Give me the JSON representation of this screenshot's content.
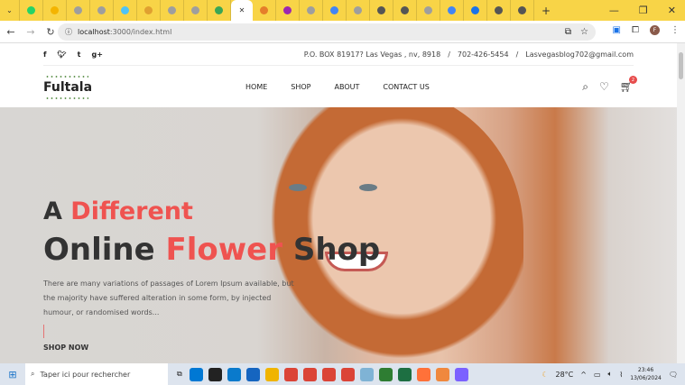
{
  "browser": {
    "tab_colors": [
      "#25d366",
      "#f4b400",
      "#9e9e9e",
      "#9e9e9e",
      "#4fc3f7",
      "#e0a030",
      "#9e9e9e",
      "#9e9e9e",
      "#3aa655"
    ],
    "tab_colors_right": [
      "#e57e2a",
      "#9c27b0",
      "#9e9e9e",
      "#4285f4",
      "#9e9e9e",
      "#555555",
      "#555555",
      "#9e9e9e",
      "#4285f4",
      "#1a73e8",
      "#555555",
      "#555555"
    ],
    "new_tab": "+",
    "minimize": "—",
    "restore": "❐",
    "close": "✕",
    "url_host": "localhost",
    "url_rest": ":3000/index.html",
    "profile_initial": "F"
  },
  "topbar": {
    "social": [
      "f",
      "t",
      "t",
      "g+"
    ],
    "address": "P.O. BOX 81917? Las Vegas , nv, 8918",
    "slash": "/",
    "phone": "702-426-5454",
    "email": "Lasvegasblog702@gmail.com"
  },
  "header": {
    "logo": "Fultala",
    "menu": [
      "HOME",
      "SHOP",
      "ABOUT",
      "CONTACT US"
    ],
    "cart_count": "2"
  },
  "hero": {
    "line1_a": "A ",
    "line1_b": "Different",
    "line2_a": "Online ",
    "line2_b": "Flower",
    "line2_c": " Shop",
    "description": "There are many variations of passages of Lorem Ipsum available, but the majority have suffered alteration in some form, by injected humour, or randomised words...",
    "cta": "SHOP NOW"
  },
  "taskbar": {
    "search_placeholder": "Taper ici pour rechercher",
    "app_colors": [
      "#0078d4",
      "#222222",
      "#0a7acc",
      "#1565c0",
      "#f0b400",
      "#db4437",
      "#db4437",
      "#db4437",
      "#db4437",
      "#7fb3d5",
      "#2e7d32",
      "#1d6f42",
      "#ff7139",
      "#f0883e",
      "#7b61ff"
    ],
    "weather": "28°C",
    "time": "23:46",
    "date": "13/06/2024"
  }
}
